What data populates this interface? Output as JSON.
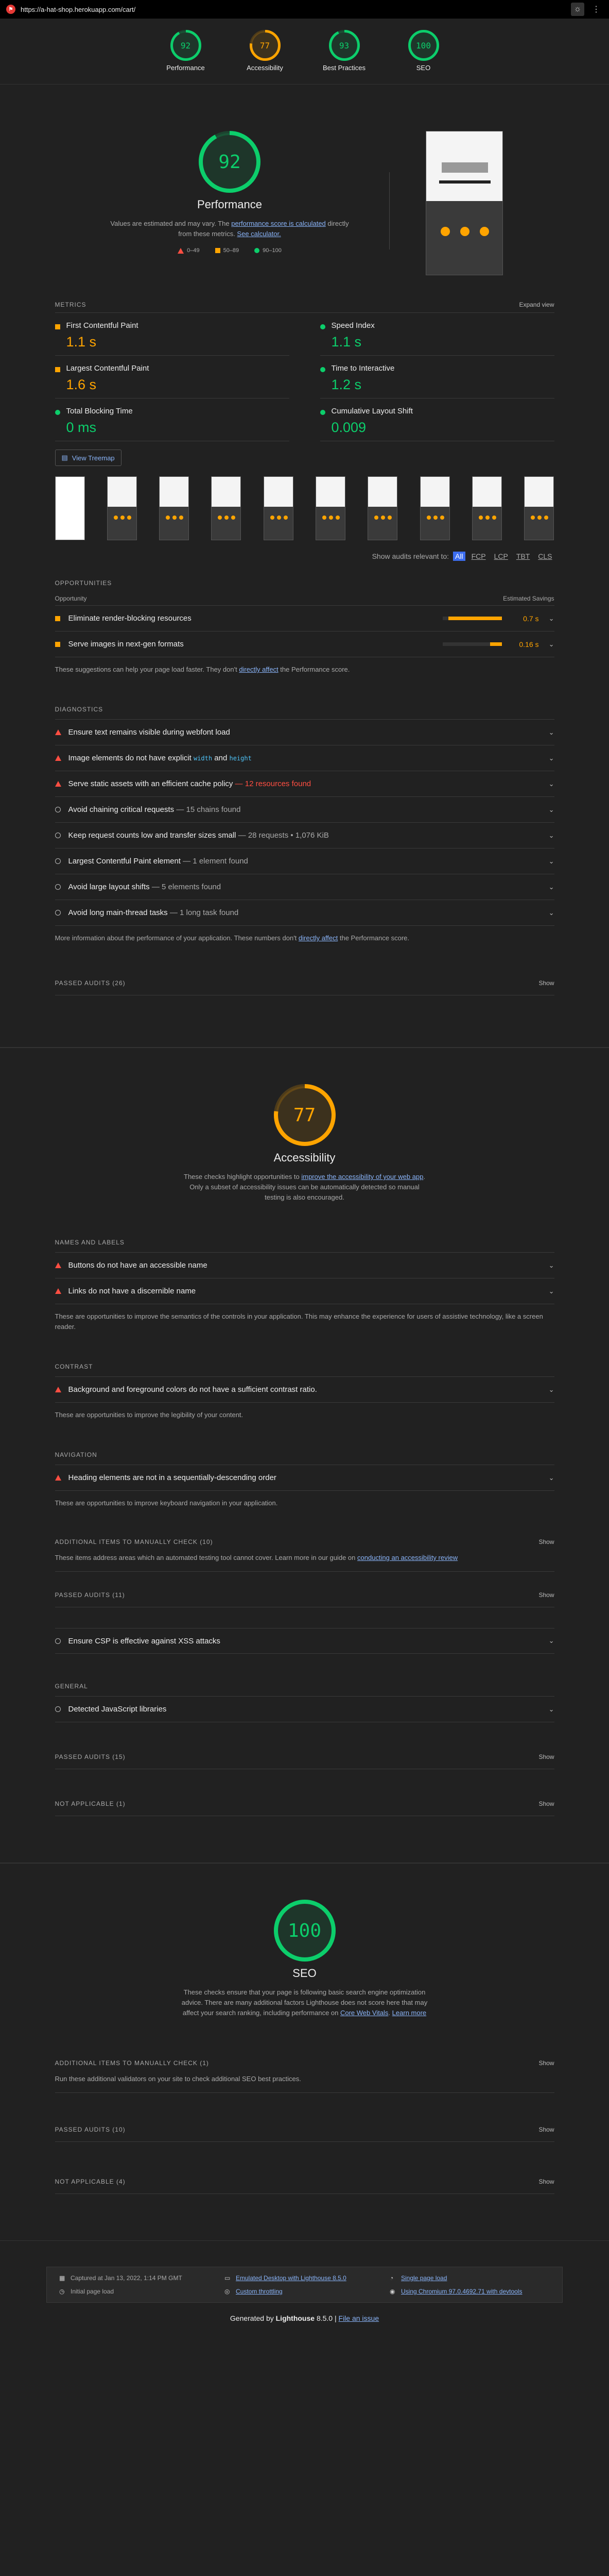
{
  "browser": {
    "url": "https://a-hat-shop.herokuapp.com/cart/"
  },
  "summary": [
    {
      "label": "Performance",
      "score": "92",
      "fraction": 0.92,
      "color": "#0cce6b"
    },
    {
      "label": "Accessibility",
      "score": "77",
      "fraction": 0.77,
      "color": "#ffa400"
    },
    {
      "label": "Best Practices",
      "score": "93",
      "fraction": 0.93,
      "color": "#0cce6b"
    },
    {
      "label": "SEO",
      "score": "100",
      "fraction": 1.0,
      "color": "#0cce6b"
    }
  ],
  "performance": {
    "score": "92",
    "fraction": 0.92,
    "color": "#0cce6b",
    "title": "Performance",
    "desc_pre": "Values are estimated and may vary. The ",
    "desc_link1": "performance score is calculated",
    "desc_mid": " directly from these metrics. ",
    "desc_link2": "See calculator.",
    "legend": [
      "0–49",
      "50–89",
      "90–100"
    ],
    "metrics_label": "METRICS",
    "expand": "Expand view",
    "metrics": [
      {
        "name": "First Contentful Paint",
        "value": "1.1 s",
        "status": "orange"
      },
      {
        "name": "Speed Index",
        "value": "1.1 s",
        "status": "green"
      },
      {
        "name": "Largest Contentful Paint",
        "value": "1.6 s",
        "status": "orange"
      },
      {
        "name": "Time to Interactive",
        "value": "1.2 s",
        "status": "green"
      },
      {
        "name": "Total Blocking Time",
        "value": "0 ms",
        "status": "green"
      },
      {
        "name": "Cumulative Layout Shift",
        "value": "0.009",
        "status": "green"
      }
    ],
    "treemap": "View Treemap",
    "filter_label": "Show audits relevant to:",
    "filters": [
      "All",
      "FCP",
      "LCP",
      "TBT",
      "CLS"
    ],
    "opportunities_label": "OPPORTUNITIES",
    "col_opp": "Opportunity",
    "col_save": "Estimated Savings",
    "opportunities": [
      {
        "title": "Eliminate render-blocking resources",
        "savings": "0.7 s",
        "fraction": 0.9
      },
      {
        "title": "Serve images in next-gen formats",
        "savings": "0.16 s",
        "fraction": 0.2
      }
    ],
    "opp_note_pre": "These suggestions can help your page load faster. They don't ",
    "opp_note_link": "directly affect",
    "opp_note_post": " the Performance score.",
    "diagnostics_label": "DIAGNOSTICS",
    "diagnostics": [
      {
        "icon": "fail",
        "title": "Ensure text remains visible during webfont load",
        "extra": ""
      },
      {
        "icon": "fail",
        "title": "Image elements do not have explicit ",
        "code1": "width",
        "mid": " and ",
        "code2": "height",
        "extra": ""
      },
      {
        "icon": "fail",
        "title": "Serve static assets with an efficient cache policy",
        "extra": " — 12 resources found",
        "extraRed": true
      },
      {
        "icon": "info",
        "title": "Avoid chaining critical requests",
        "extra": " — 15 chains found"
      },
      {
        "icon": "info",
        "title": "Keep request counts low and transfer sizes small",
        "extra": " — 28 requests • 1,076 KiB"
      },
      {
        "icon": "info",
        "title": "Largest Contentful Paint element",
        "extra": " — 1 element found"
      },
      {
        "icon": "info",
        "title": "Avoid large layout shifts",
        "extra": " — 5 elements found"
      },
      {
        "icon": "info",
        "title": "Avoid long main-thread tasks",
        "extra": " — 1 long task found"
      }
    ],
    "diag_note_pre": "More information about the performance of your application. These numbers don't ",
    "diag_note_link": "directly affect",
    "diag_note_post": " the Performance score.",
    "passed": "PASSED AUDITS (26)",
    "show": "Show"
  },
  "accessibility": {
    "score": "77",
    "fraction": 0.77,
    "color": "#ffa400",
    "title": "Accessibility",
    "desc_pre": "These checks highlight opportunities to ",
    "desc_link": "improve the accessibility of your web app",
    "desc_post": ". Only a subset of accessibility issues can be automatically detected so manual testing is also encouraged.",
    "groups": [
      {
        "label": "NAMES AND LABELS",
        "audits": [
          "Buttons do not have an accessible name",
          "Links do not have a discernible name"
        ],
        "note": "These are opportunities to improve the semantics of the controls in your application. This may enhance the experience for users of assistive technology, like a screen reader."
      },
      {
        "label": "CONTRAST",
        "audits": [
          "Background and foreground colors do not have a sufficient contrast ratio."
        ],
        "note": "These are opportunities to improve the legibility of your content."
      },
      {
        "label": "NAVIGATION",
        "audits": [
          "Heading elements are not in a sequentially-descending order"
        ],
        "note": "These are opportunities to improve keyboard navigation in your application."
      }
    ],
    "manual": "ADDITIONAL ITEMS TO MANUALLY CHECK (10)",
    "manual_note_pre": "These items address areas which an automated testing tool cannot cover. Learn more in our guide on ",
    "manual_note_link": "conducting an accessibility review",
    "passed": "PASSED AUDITS (11)",
    "na": "NOT APPLICABLE (1)",
    "show": "Show"
  },
  "best_practices_fragment": {
    "audit1": "Ensure CSP is effective against XSS attacks",
    "general": "GENERAL",
    "audit2": "Detected JavaScript libraries",
    "passed": "PASSED AUDITS (15)",
    "na": "NOT APPLICABLE (1)",
    "show": "Show"
  },
  "seo": {
    "score": "100",
    "fraction": 1.0,
    "color": "#0cce6b",
    "title": "SEO",
    "desc_pre": "These checks ensure that your page is following basic search engine optimization advice. There are many additional factors Lighthouse does not score here that may affect your search ranking, including performance on ",
    "desc_link1": "Core Web Vitals",
    "desc_mid": ". ",
    "desc_link2": "Learn more",
    "manual": "ADDITIONAL ITEMS TO MANUALLY CHECK (1)",
    "manual_note": "Run these additional validators on your site to check additional SEO best practices.",
    "passed": "PASSED AUDITS (10)",
    "na": "NOT APPLICABLE (4)",
    "show": "Show"
  },
  "footer": {
    "captured": "Captured at Jan 13, 2022, 1:14 PM GMT",
    "initial": "Initial page load",
    "emulated": "Emulated Desktop with Lighthouse 8.5.0",
    "throttling": "Custom throttling",
    "single": "Single page load",
    "chromium": "Using Chromium 97.0.4692.71 with devtools",
    "gen_pre": "Generated by ",
    "gen_brand": "Lighthouse",
    "gen_ver": " 8.5.0 | ",
    "gen_link": "File an issue"
  }
}
